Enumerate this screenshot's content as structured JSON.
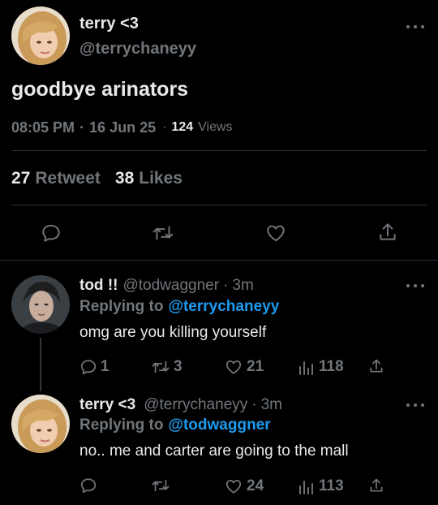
{
  "main_tweet": {
    "display_name": "terry <3",
    "handle": "@terrychaneyy",
    "text": "goodbye arinators",
    "time": "08:05 PM",
    "date": "16 Jun 25",
    "views_count": "124",
    "views_label": "Views",
    "retweets_count": "27",
    "retweets_label": "Retweet",
    "likes_count": "38",
    "likes_label": "Likes"
  },
  "replies": [
    {
      "display_name": "tod !!",
      "handle": "@todwaggner",
      "time": "3m",
      "replying_label": "Replying to",
      "replying_to": "@terrychaneyy",
      "text": "omg are you killing yourself",
      "replies": "1",
      "retweets": "3",
      "likes": "21",
      "views": "118"
    },
    {
      "display_name": "terry <3",
      "handle": "@terrychaneyy",
      "time": "3m",
      "replying_label": "Replying to",
      "replying_to": "@todwaggner",
      "text": "no.. me and carter are going to the mall",
      "likes": "24",
      "views": "113"
    }
  ],
  "separator": "·"
}
